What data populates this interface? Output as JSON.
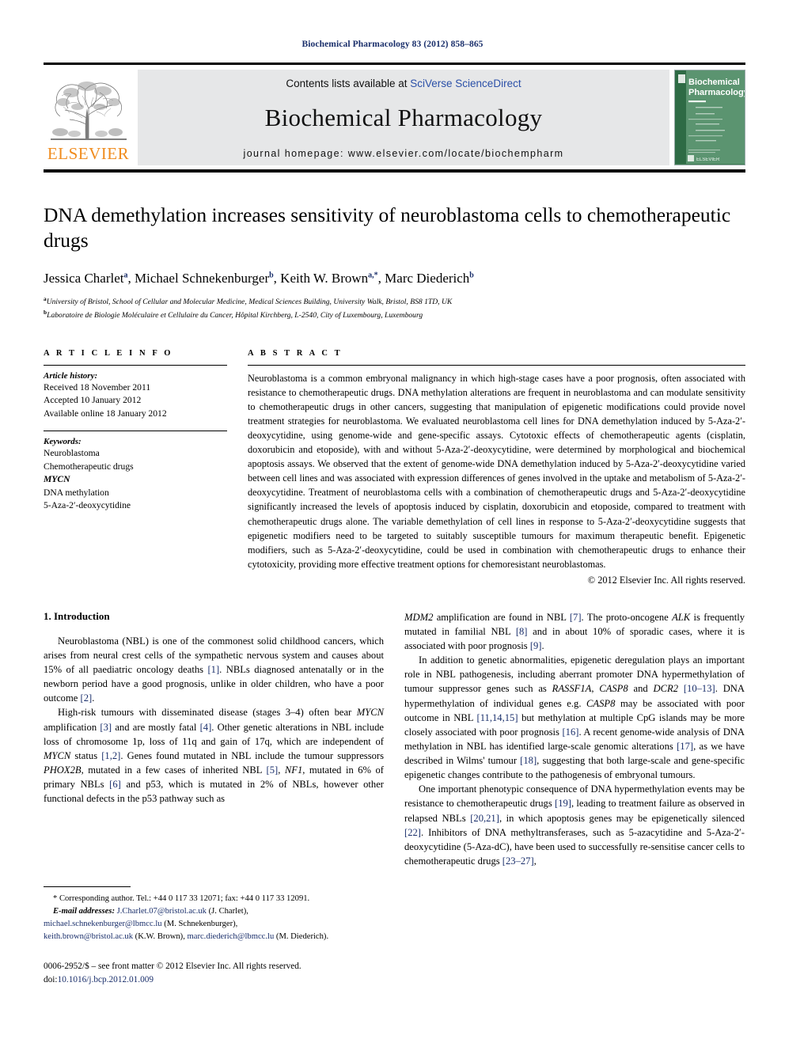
{
  "running_head": "Biochemical Pharmacology 83 (2012) 858–865",
  "masthead": {
    "publisher_name": "ELSEVIER",
    "contents_prefix": "Contents lists available at ",
    "contents_link": "SciVerse ScienceDirect",
    "journal_title": "Biochemical Pharmacology",
    "homepage": "journal homepage: www.elsevier.com/locate/biochempharm",
    "cover_title_line1": "Biochemical",
    "cover_title_line2": "Pharmacology",
    "cover_footer": "ELSEVIER"
  },
  "article": {
    "title": "DNA demethylation increases sensitivity of neuroblastoma cells to chemotherapeutic drugs",
    "authors": [
      {
        "name": "Jessica Charlet",
        "marks": "a"
      },
      {
        "name": "Michael Schnekenburger",
        "marks": "b"
      },
      {
        "name": "Keith W. Brown",
        "marks": "a,*"
      },
      {
        "name": "Marc Diederich",
        "marks": "b"
      }
    ],
    "affiliations": [
      {
        "mark": "a",
        "text": "University of Bristol, School of Cellular and Molecular Medicine, Medical Sciences Building, University Walk, Bristol, BS8 1TD, UK"
      },
      {
        "mark": "b",
        "text": "Laboratoire de Biologie Moléculaire et Cellulaire du Cancer, Hôpital Kirchberg, L-2540, City of Luxembourg, Luxembourg"
      }
    ]
  },
  "article_info": {
    "heading": "A R T I C L E   I N F O",
    "history_label": "Article history:",
    "history": [
      "Received 18 November 2011",
      "Accepted 10 January 2012",
      "Available online 18 January 2012"
    ],
    "keywords_label": "Keywords:",
    "keywords": [
      {
        "text": "Neuroblastoma",
        "italic": false
      },
      {
        "text": "Chemotherapeutic drugs",
        "italic": false
      },
      {
        "text": "MYCN",
        "italic": true
      },
      {
        "text": "DNA methylation",
        "italic": false
      },
      {
        "text": "5-Aza-2′-deoxycytidine",
        "italic": false
      }
    ]
  },
  "abstract": {
    "heading": "A B S T R A C T",
    "text": "Neuroblastoma is a common embryonal malignancy in which high-stage cases have a poor prognosis, often associated with resistance to chemotherapeutic drugs. DNA methylation alterations are frequent in neuroblastoma and can modulate sensitivity to chemotherapeutic drugs in other cancers, suggesting that manipulation of epigenetic modifications could provide novel treatment strategies for neuroblastoma. We evaluated neuroblastoma cell lines for DNA demethylation induced by 5-Aza-2′-deoxycytidine, using genome-wide and gene-specific assays. Cytotoxic effects of chemotherapeutic agents (cisplatin, doxorubicin and etoposide), with and without 5-Aza-2′-deoxycytidine, were determined by morphological and biochemical apoptosis assays. We observed that the extent of genome-wide DNA demethylation induced by 5-Aza-2′-deoxycytidine varied between cell lines and was associated with expression differences of genes involved in the uptake and metabolism of 5-Aza-2′-deoxycytidine. Treatment of neuroblastoma cells with a combination of chemotherapeutic drugs and 5-Aza-2′-deoxycytidine significantly increased the levels of apoptosis induced by cisplatin, doxorubicin and etoposide, compared to treatment with chemotherapeutic drugs alone. The variable demethylation of cell lines in response to 5-Aza-2′-deoxycytidine suggests that epigenetic modifiers need to be targeted to suitably susceptible tumours for maximum therapeutic benefit. Epigenetic modifiers, such as 5-Aza-2′-deoxycytidine, could be used in combination with chemotherapeutic drugs to enhance their cytotoxicity, providing more effective treatment options for chemoresistant neuroblastomas.",
    "copyright": "© 2012 Elsevier Inc. All rights reserved."
  },
  "introduction": {
    "heading": "1.  Introduction",
    "left_paragraphs": [
      "Neuroblastoma (NBL) is one of the commonest solid childhood cancers, which arises from neural crest cells of the sympathetic nervous system and causes about 15% of all paediatric oncology deaths [1]. NBLs diagnosed antenatally or in the newborn period have a good prognosis, unlike in older children, who have a poor outcome [2].",
      "High-risk tumours with disseminated disease (stages 3–4) often bear MYCN amplification [3] and are mostly fatal [4]. Other genetic alterations in NBL include loss of chromosome 1p, loss of 11q and gain of 17q, which are independent of MYCN status [1,2]. Genes found mutated in NBL include the tumour suppressors PHOX2B, mutated in a few cases of inherited NBL [5], NF1, mutated in 6% of primary NBLs [6] and p53, which is mutated in 2% of NBLs, however other functional defects in the p53 pathway such as"
    ],
    "right_paragraphs": [
      "MDM2 amplification are found in NBL [7]. The proto-oncogene ALK is frequently mutated in familial NBL [8] and in about 10% of sporadic cases, where it is associated with poor prognosis [9].",
      "In addition to genetic abnormalities, epigenetic deregulation plays an important role in NBL pathogenesis, including aberrant promoter DNA hypermethylation of tumour suppressor genes such as RASSF1A, CASP8 and DCR2 [10–13]. DNA hypermethylation of individual genes e.g. CASP8 may be associated with poor outcome in NBL [11,14,15] but methylation at multiple CpG islands may be more closely associated with poor prognosis [16]. A recent genome-wide analysis of DNA methylation in NBL has identified large-scale genomic alterations [17], as we have described in Wilms' tumour [18], suggesting that both large-scale and gene-specific epigenetic changes contribute to the pathogenesis of embryonal tumours.",
      "One important phenotypic consequence of DNA hypermethylation events may be resistance to chemotherapeutic drugs [19], leading to treatment failure as observed in relapsed NBLs [20,21], in which apoptosis genes may be epigenetically silenced [22]. Inhibitors of DNA methyltransferases, such as 5-azacytidine and 5-Aza-2′-deoxycytidine (5-Aza-dC), have been used to successfully re-sensitise cancer cells to chemotherapeutic drugs [23–27],"
    ]
  },
  "footnotes": {
    "corresponding": "* Corresponding author. Tel.: +44 0 117 33 12071; fax: +44 0 117 33 12091.",
    "email_label": "E-mail addresses:",
    "emails": [
      {
        "address": "J.Charlet.07@bristol.ac.uk",
        "owner": "(J. Charlet),"
      },
      {
        "address": "michael.schnekenburger@lbmcc.lu",
        "owner": "(M. Schnekenburger),"
      },
      {
        "address": "keith.brown@bristol.ac.uk",
        "owner": "(K.W. Brown),"
      },
      {
        "address": "marc.diederich@lbmcc.lu",
        "owner": "(M. Diederich)."
      }
    ]
  },
  "imprint": {
    "line1": "0006-2952/$ – see front matter © 2012 Elsevier Inc. All rights reserved.",
    "doi_label": "doi:",
    "doi_value": "10.1016/j.bcp.2012.01.009"
  },
  "colors": {
    "link_blue": "#2b50a8",
    "ref_blue": "#1a2f6b",
    "elsevier_orange": "#F08C1E",
    "band_grey": "#e6e7e8",
    "cover_green": "#3f7d52"
  }
}
